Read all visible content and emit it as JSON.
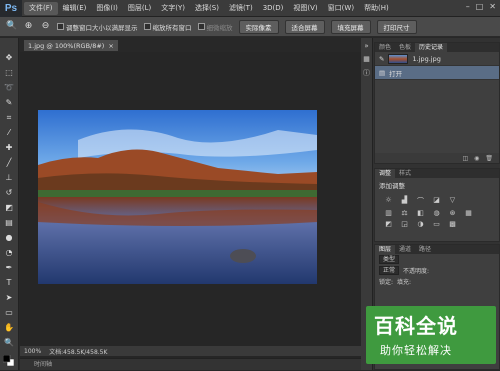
{
  "app": {
    "logo": "Ps"
  },
  "menu": [
    "文件(F)",
    "编辑(E)",
    "图像(I)",
    "图层(L)",
    "文字(Y)",
    "选择(S)",
    "滤镜(T)",
    "3D(D)",
    "视图(V)",
    "窗口(W)",
    "帮助(H)"
  ],
  "options": {
    "checkbox1": "调整窗口大小以满屏显示",
    "checkbox2": "缩放所有窗口",
    "checkbox3": "细微缩放",
    "btn1": "实际像素",
    "btn2": "适合屏幕",
    "btn3": "填充屏幕",
    "btn4": "打印尺寸"
  },
  "document": {
    "tab": "1.jpg @ 100%(RGB/8#)",
    "zoom": "100%",
    "docinfo": "文档:458.5K/458.5K",
    "timeline": "时间轴"
  },
  "history": {
    "tab_color": "颜色",
    "tab_swatch": "色板",
    "tab_history": "历史记录",
    "snapshot": "1.jpg.jpg",
    "step": "打开"
  },
  "adjust": {
    "tab1": "调整",
    "tab2": "样式",
    "title": "添加调整"
  },
  "layers": {
    "tab1": "图层",
    "tab2": "通道",
    "tab3": "路径",
    "kind": "类型",
    "blend": "正常",
    "opacity_label": "不透明度:",
    "lock": "锁定:",
    "fill": "填充:"
  },
  "watermark": {
    "line1": "百科全说",
    "line2": "助你轻松解决"
  },
  "icons": [
    "move-icon",
    "marquee-icon",
    "lasso-icon",
    "quick-select-icon",
    "crop-icon",
    "eyedropper-icon",
    "healing-icon",
    "brush-icon",
    "stamp-icon",
    "history-brush-icon",
    "eraser-icon",
    "gradient-icon",
    "blur-icon",
    "dodge-icon",
    "pen-icon",
    "type-icon",
    "path-select-icon",
    "shape-icon",
    "hand-icon",
    "zoom-icon"
  ]
}
